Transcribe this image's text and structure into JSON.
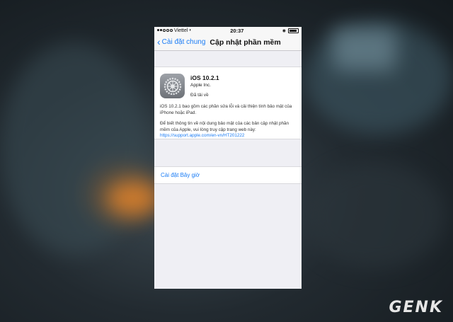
{
  "status_bar": {
    "carrier": "Viettel",
    "time": "20:37",
    "signal_icon": "signal-dots-icon",
    "wifi_icon": "wifi-icon",
    "lock_icon": "rotation-lock-icon",
    "battery_icon": "battery-icon"
  },
  "nav": {
    "back_label": "Cài đặt chung",
    "title": "Cập nhật phần mềm"
  },
  "update": {
    "name": "iOS 10.2.1",
    "vendor": "Apple Inc.",
    "status": "Đã tải về",
    "description_1": "iOS 10.2.1 bao gồm các phần sửa lỗi và cải thiện tính bảo mật của iPhone hoặc iPad.",
    "description_2": "Để biết thông tin về nội dung bảo mật của các bản cập nhật phần mềm của Apple, vui lòng truy cập trang web này:",
    "link": "https://support.apple.com/en-vn/HT201222"
  },
  "install_label": "Cài đặt Bây giờ",
  "watermark": "GENK",
  "colors": {
    "accent": "#1a7cf5",
    "background": "#efeff4"
  }
}
